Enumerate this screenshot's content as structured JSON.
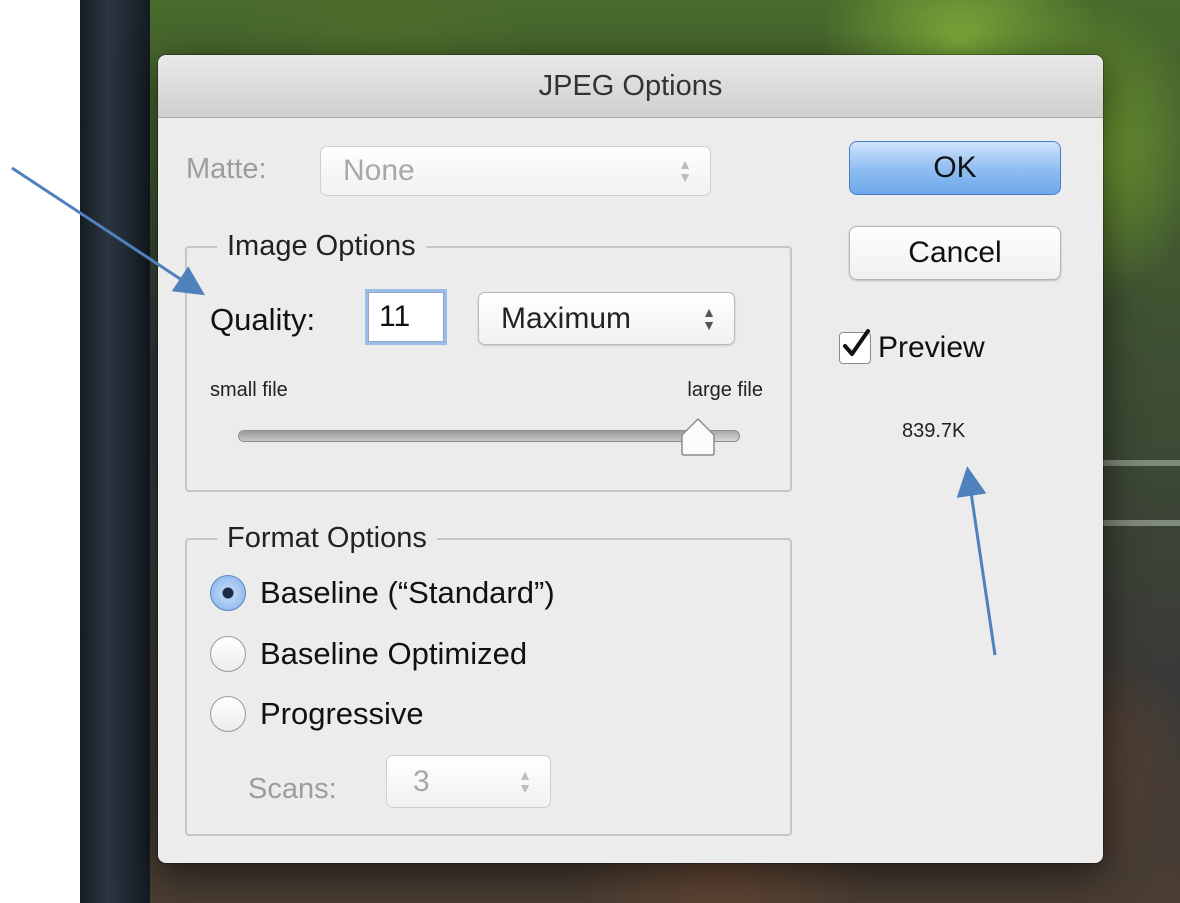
{
  "dialog": {
    "title": "JPEG Options",
    "matte": {
      "label": "Matte:",
      "value": "None"
    },
    "image_options": {
      "legend": "Image Options",
      "quality_label": "Quality:",
      "quality_value": "11",
      "quality_preset": "Maximum",
      "small_label": "small file",
      "large_label": "large file",
      "slider_value_fraction": 0.92
    },
    "format_options": {
      "legend": "Format Options",
      "options": [
        "Baseline (“Standard”)",
        "Baseline Optimized",
        "Progressive"
      ],
      "selected_index": 0,
      "scans": {
        "label": "Scans:",
        "value": "3"
      }
    },
    "buttons": {
      "ok": "OK",
      "cancel": "Cancel"
    },
    "preview": {
      "label": "Preview",
      "checked": true
    },
    "file_size": "839.7K"
  },
  "annotations": {
    "arrow_color": "#4f81bd"
  },
  "icons": [
    "updown-arrows-icon",
    "checkmark-icon",
    "slider-thumb-icon",
    "annotation-arrow-icon"
  ]
}
